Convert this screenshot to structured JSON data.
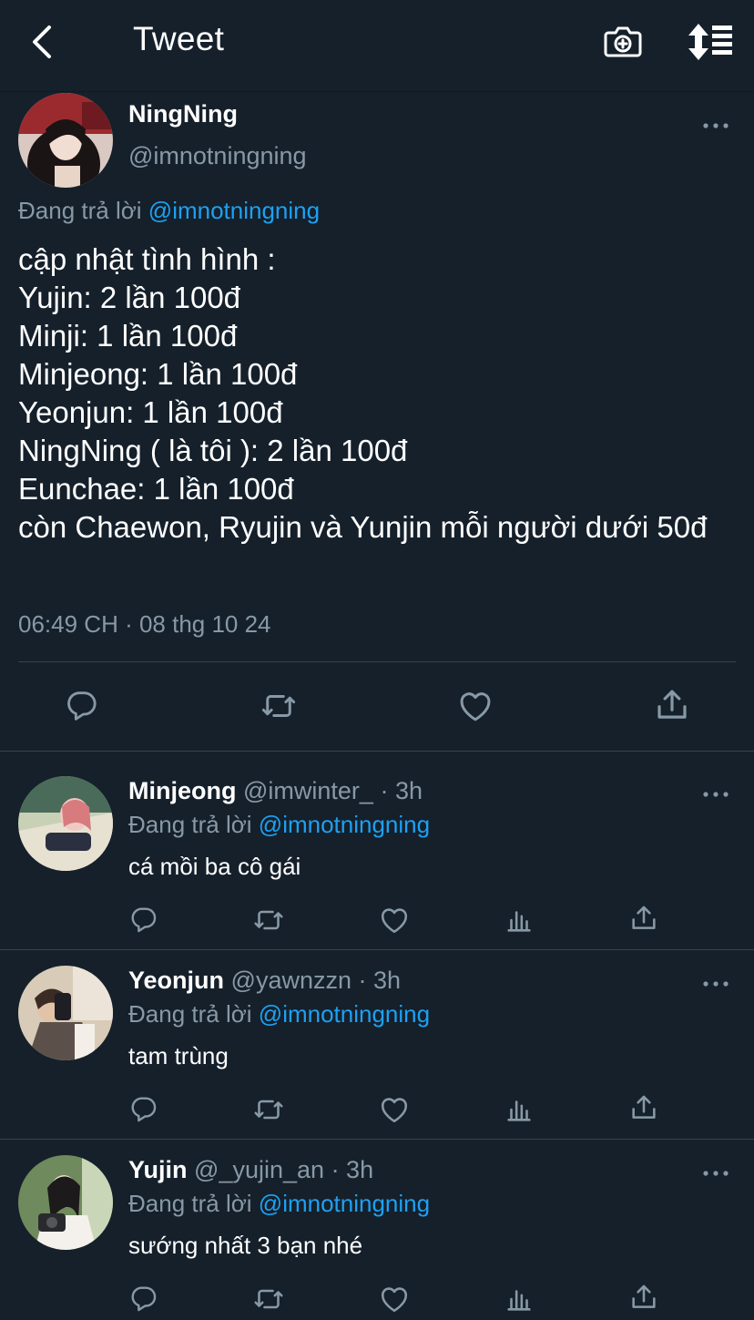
{
  "header": {
    "title": "Tweet"
  },
  "main_tweet": {
    "name": "NingNing",
    "handle": "@imnotningning",
    "replying_prefix": "Đang trả lời",
    "replying_to": "@imnotningning",
    "text": "cập nhật tình hình :\nYujin: 2 lần 100đ\nMinji: 1 lần 100đ\nMinjeong: 1 lần 100đ\nYeonjun: 1 lần 100đ\nNingNing ( là tôi ): 2 lần 100đ\nEunchae: 1 lần 100đ\ncòn Chaewon, Ryujin và Yunjin mỗi người dưới 50đ",
    "timestamp": "06:49 CH · 08 thg 10 24"
  },
  "replies": [
    {
      "name": "Minjeong",
      "handle": "@imwinter_",
      "time": "· 3h",
      "replying_prefix": "Đang trả lời",
      "replying_to": "@imnotningning",
      "text": "cá mồi ba cô gái"
    },
    {
      "name": "Yeonjun",
      "handle": "@yawnzzn",
      "time": "· 3h",
      "replying_prefix": "Đang trả lời",
      "replying_to": "@imnotningning",
      "text": "tam trùng"
    },
    {
      "name": "Yujin",
      "handle": "@_yujin_an",
      "time": "· 3h",
      "replying_prefix": "Đang trả lời",
      "replying_to": "@imnotningning",
      "text": "sướng nhất 3 bạn nhé"
    }
  ],
  "colors": {
    "background": "#15202b",
    "secondary_text": "#8899a6",
    "accent": "#1da1f2",
    "divider": "#38444d"
  },
  "icons": [
    "back-arrow-icon",
    "camera-icon",
    "sort-icon",
    "more-icon",
    "reply-icon",
    "retweet-icon",
    "like-icon",
    "analytics-icon",
    "share-icon"
  ]
}
